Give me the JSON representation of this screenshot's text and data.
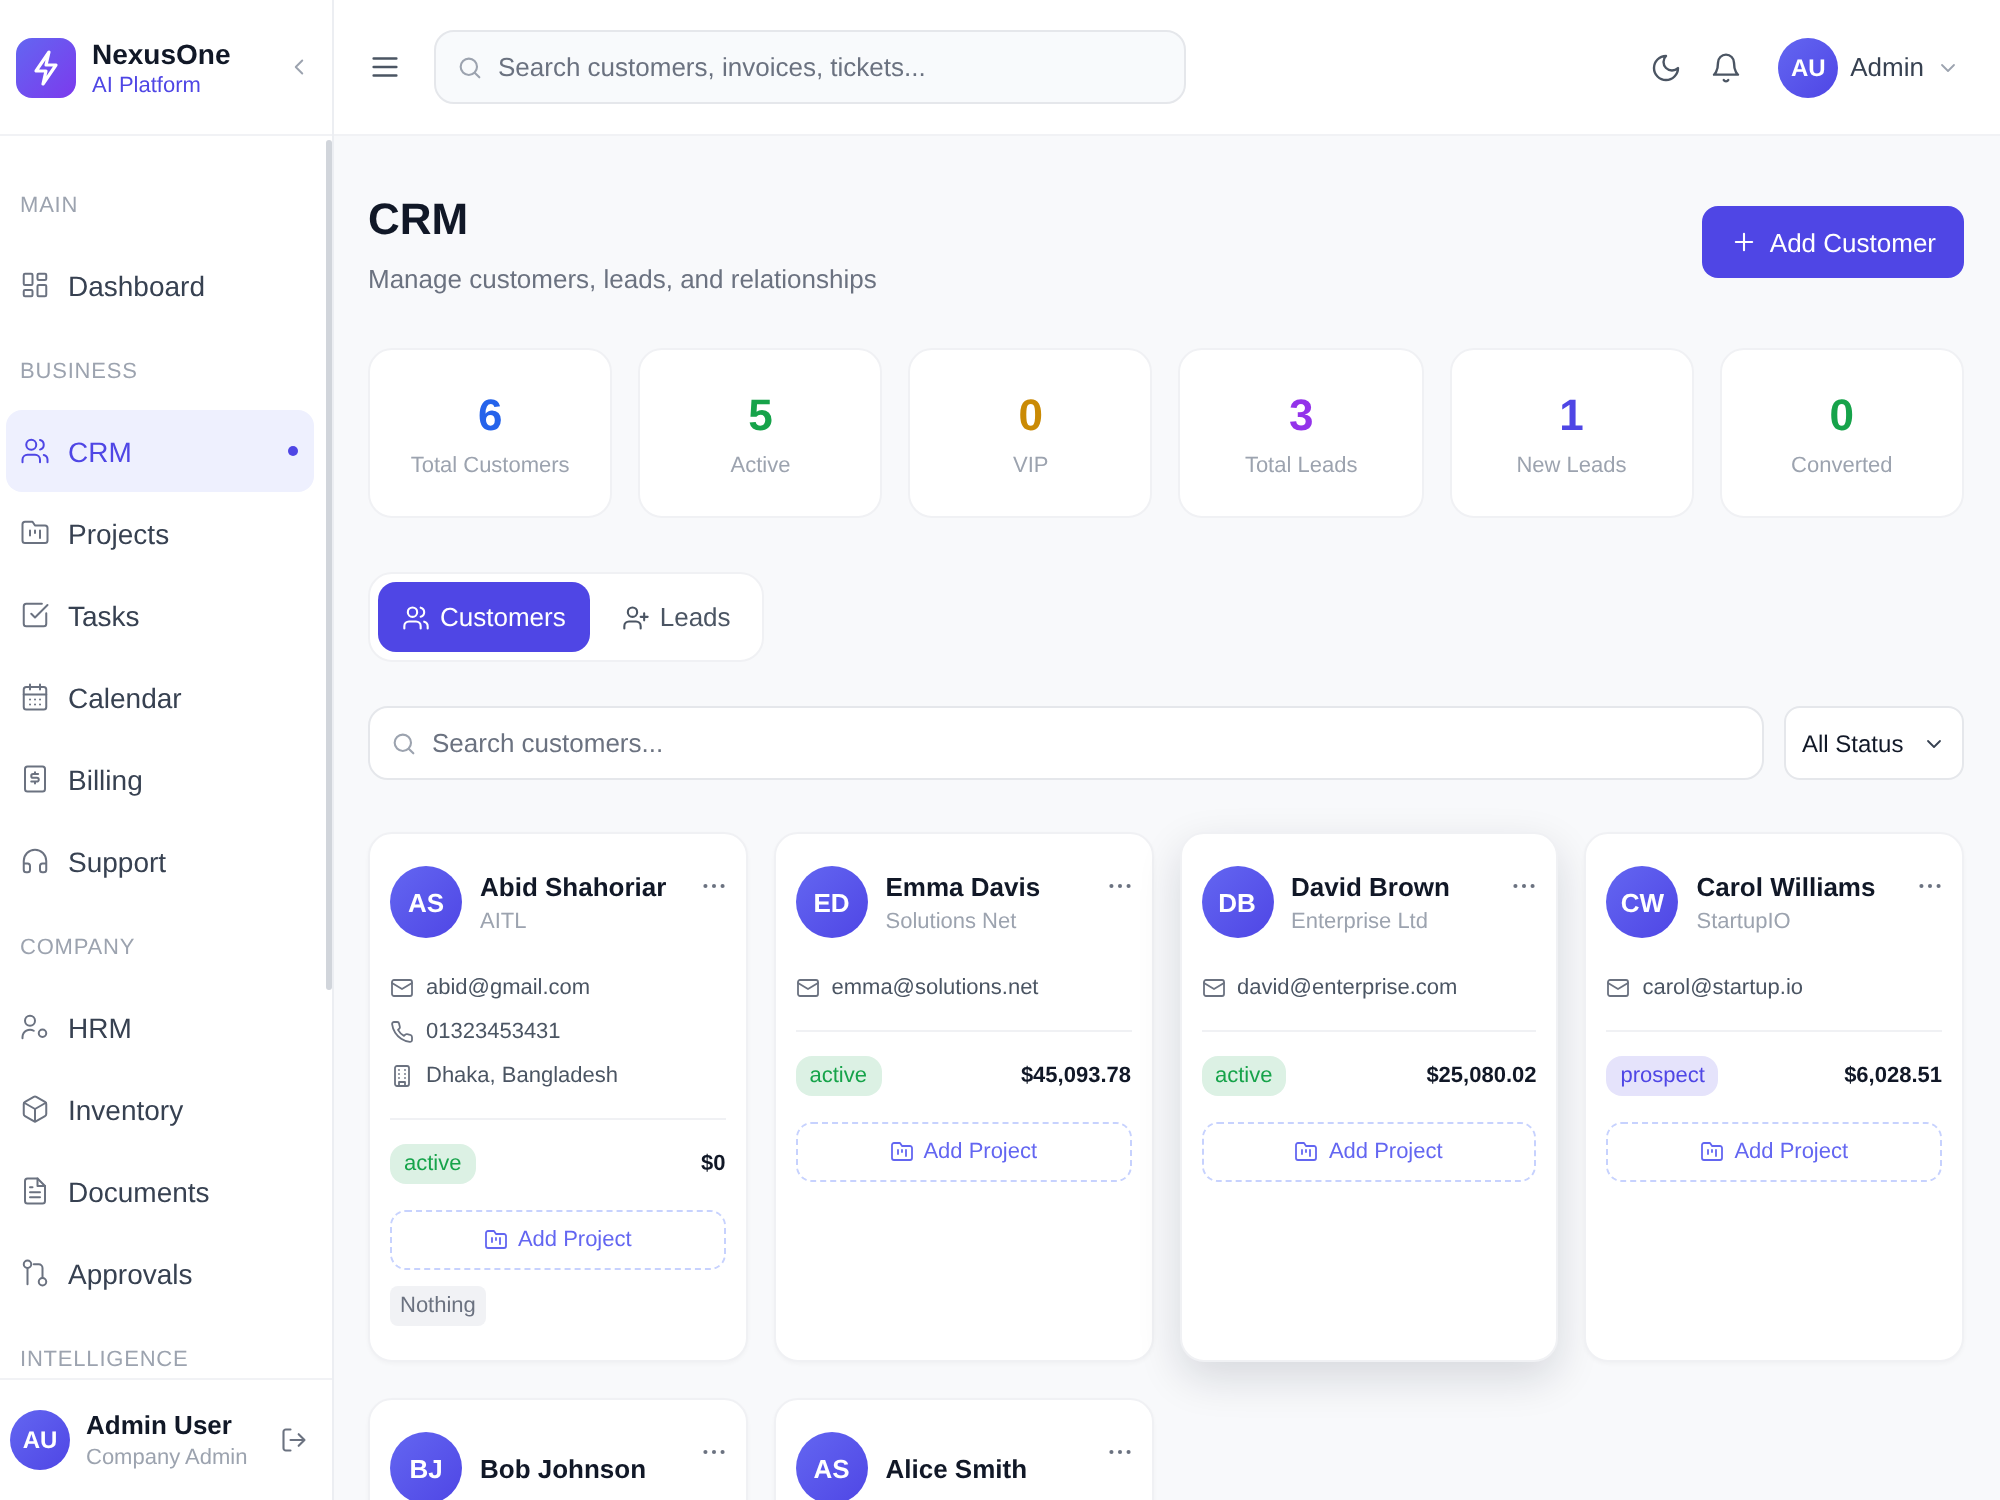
{
  "sidebar": {
    "brand": {
      "name": "NexusOne",
      "tagline": "AI Platform"
    },
    "sections": [
      {
        "title": "MAIN",
        "items": [
          {
            "label": "Dashboard",
            "selected": false
          }
        ]
      },
      {
        "title": "BUSINESS",
        "items": [
          {
            "label": "CRM",
            "selected": true
          },
          {
            "label": "Projects",
            "selected": false
          },
          {
            "label": "Tasks",
            "selected": false
          },
          {
            "label": "Calendar",
            "selected": false
          },
          {
            "label": "Billing",
            "selected": false
          },
          {
            "label": "Support",
            "selected": false
          }
        ]
      },
      {
        "title": "COMPANY",
        "items": [
          {
            "label": "HRM",
            "selected": false
          },
          {
            "label": "Inventory",
            "selected": false
          },
          {
            "label": "Documents",
            "selected": false
          },
          {
            "label": "Approvals",
            "selected": false
          }
        ]
      },
      {
        "title": "INTELLIGENCE"
      }
    ],
    "user": {
      "initials": "AU",
      "name": "Admin User",
      "role": "Company Admin"
    }
  },
  "header": {
    "search": {
      "placeholder": "Search customers, invoices, tickets..."
    },
    "account": {
      "initials": "AU",
      "name": "Admin"
    }
  },
  "page": {
    "title": "CRM",
    "subtitle": "Manage customers, leads, and relationships",
    "add_button": {
      "label": "Add Customer"
    }
  },
  "stats": [
    {
      "value": "6",
      "label": "Total Customers",
      "color": "#2563eb"
    },
    {
      "value": "5",
      "label": "Active",
      "color": "#16a34a"
    },
    {
      "value": "0",
      "label": "VIP",
      "color": "#ca8a04"
    },
    {
      "value": "3",
      "label": "Total Leads",
      "color": "#9333ea"
    },
    {
      "value": "1",
      "label": "New Leads",
      "color": "#4f46e5"
    },
    {
      "value": "0",
      "label": "Converted",
      "color": "#16a34a"
    }
  ],
  "tabs": [
    {
      "label": "Customers",
      "selected": true
    },
    {
      "label": "Leads",
      "selected": false
    }
  ],
  "filters": {
    "search": {
      "placeholder": "Search customers..."
    },
    "status": {
      "value": "All Status"
    }
  },
  "customers": [
    {
      "initials": "AS",
      "name": "Abid Shahoriar",
      "company": "AITL",
      "hovered": false,
      "contacts": [
        {
          "kind": "email",
          "text": "abid@gmail.com"
        },
        {
          "kind": "phone",
          "text": "01323453431"
        },
        {
          "kind": "address",
          "text": "Dhaka, Bangladesh"
        }
      ],
      "status": {
        "label": "active",
        "color": "#16a34a"
      },
      "amount": "$0",
      "action": "Add Project",
      "project_tags": [
        "Nothing"
      ]
    },
    {
      "initials": "ED",
      "name": "Emma Davis",
      "company": "Solutions Net",
      "hovered": false,
      "contacts": [
        {
          "kind": "email",
          "text": "emma@solutions.net"
        }
      ],
      "status": {
        "label": "active",
        "color": "#16a34a"
      },
      "amount": "$45,093.78",
      "action": "Add Project"
    },
    {
      "initials": "DB",
      "name": "David Brown",
      "company": "Enterprise Ltd",
      "hovered": true,
      "contacts": [
        {
          "kind": "email",
          "text": "david@enterprise.com"
        }
      ],
      "status": {
        "label": "active",
        "color": "#16a34a"
      },
      "amount": "$25,080.02",
      "action": "Add Project"
    },
    {
      "initials": "CW",
      "name": "Carol Williams",
      "company": "StartupIO",
      "hovered": false,
      "contacts": [
        {
          "kind": "email",
          "text": "carol@startup.io"
        }
      ],
      "status": {
        "label": "prospect",
        "color": "#4f46e5"
      },
      "amount": "$6,028.51",
      "action": "Add Project"
    },
    {
      "initials": "BJ",
      "name": "Bob Johnson",
      "hovered": false
    },
    {
      "initials": "AS",
      "name": "Alice Smith",
      "hovered": false
    }
  ]
}
